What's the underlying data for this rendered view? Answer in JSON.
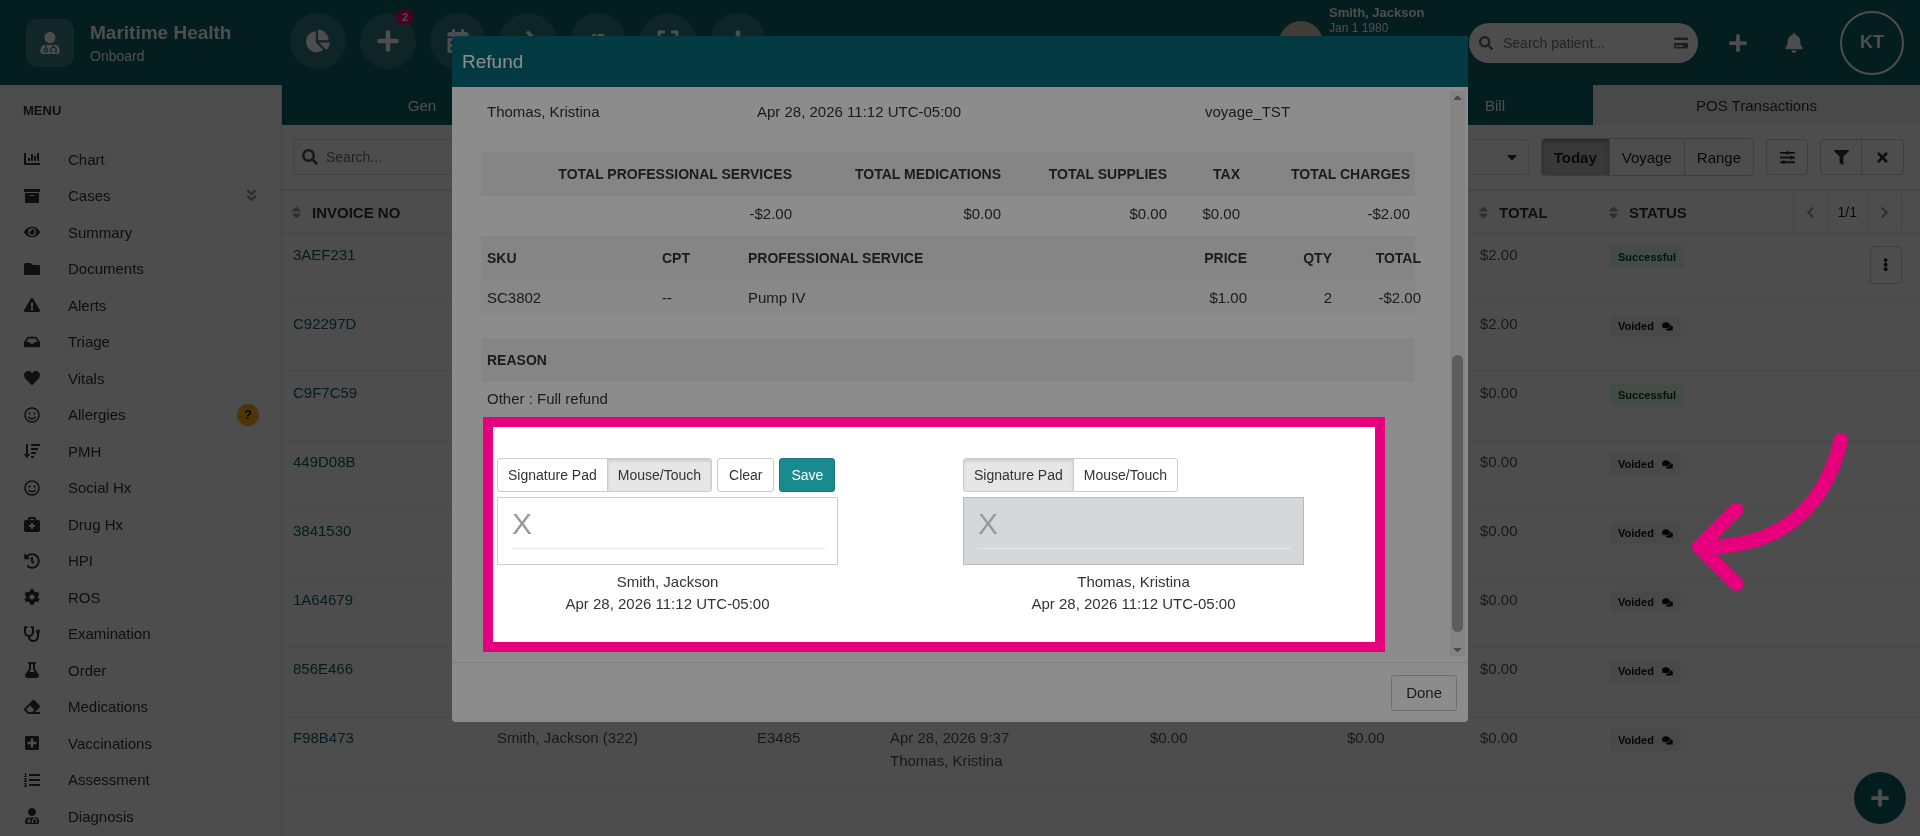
{
  "header": {
    "brand": {
      "name": "Maritime Health",
      "subtitle": "Onboard"
    },
    "new_count": "2",
    "patient": {
      "name": "Smith, Jackson",
      "dob": "Jan 1 1980"
    },
    "search": {
      "placeholder": "Search patient..."
    },
    "user_initials": "KT"
  },
  "sidebar": {
    "title": "MENU",
    "items": [
      {
        "label": "Chart",
        "expandable": false
      },
      {
        "label": "Cases",
        "expandable": true
      },
      {
        "label": "Summary",
        "expandable": false
      },
      {
        "label": "Documents",
        "expandable": false
      },
      {
        "label": "Alerts",
        "expandable": false
      },
      {
        "label": "Triage",
        "expandable": false
      },
      {
        "label": "Vitals",
        "expandable": false
      },
      {
        "label": "Allergies",
        "expandable": false,
        "badge": "?"
      },
      {
        "label": "PMH",
        "expandable": false
      },
      {
        "label": "Social Hx",
        "expandable": false
      },
      {
        "label": "Drug Hx",
        "expandable": false
      },
      {
        "label": "HPI",
        "expandable": false
      },
      {
        "label": "ROS",
        "expandable": false
      },
      {
        "label": "Examination",
        "expandable": false
      },
      {
        "label": "Order",
        "expandable": false
      },
      {
        "label": "Medications",
        "expandable": false
      },
      {
        "label": "Vaccinations",
        "expandable": false
      },
      {
        "label": "Assessment",
        "expandable": false
      },
      {
        "label": "Diagnosis",
        "expandable": false
      }
    ]
  },
  "tabs": [
    {
      "label": "Gen",
      "selected": false
    },
    {
      "label": "Bill",
      "selected": false
    },
    {
      "label": "POS Transactions",
      "selected": true
    }
  ],
  "toolbar": {
    "search_placeholder": "Search...",
    "ranges": [
      {
        "label": "Today",
        "selected": true
      },
      {
        "label": "Voyage",
        "selected": false
      },
      {
        "label": "Range",
        "selected": false
      }
    ]
  },
  "table": {
    "columns": [
      "INVOICE NO",
      "TOTAL",
      "STATUS"
    ],
    "pagination": "1/1",
    "rows": [
      {
        "invoice": "3AEF231",
        "total": "$2.00",
        "status": {
          "label": "Successful",
          "kind": "success"
        },
        "has_menu": true
      },
      {
        "invoice": "C92297D",
        "total": "$2.00",
        "status": {
          "label": "Voided",
          "kind": "voided"
        },
        "has_menu": false
      },
      {
        "invoice": "C9F7C59",
        "total": "$0.00",
        "status": {
          "label": "Successful",
          "kind": "success"
        },
        "has_menu": false
      },
      {
        "invoice": "449D08B",
        "total": "$0.00",
        "status": {
          "label": "Voided",
          "kind": "voided"
        },
        "has_menu": false
      },
      {
        "invoice": "3841530",
        "total": "$0.00",
        "status": {
          "label": "Voided",
          "kind": "voided"
        },
        "has_menu": false
      },
      {
        "invoice": "1A64679",
        "total": "$0.00",
        "status": {
          "label": "Voided",
          "kind": "voided"
        },
        "has_menu": false
      },
      {
        "invoice": "856E466",
        "total": "$0.00",
        "status": {
          "label": "Voided",
          "kind": "voided"
        },
        "has_menu": false
      },
      {
        "invoice": "F98B473",
        "total": "$0.00",
        "status": {
          "label": "Voided",
          "kind": "voided"
        },
        "has_menu": false,
        "cells": [
          [
            "Smith, Jackson (322)"
          ],
          [
            "E3485"
          ],
          [
            "Apr 28, 2026 9:37",
            "Thomas, Kristina"
          ],
          [
            "$0.00"
          ],
          [
            "$0.00"
          ]
        ]
      }
    ]
  },
  "modal": {
    "title": "Refund",
    "info": [
      "Thomas, Kristina",
      "Apr 28, 2026 11:12 UTC-05:00",
      "voyage_TST"
    ],
    "totals": {
      "columns": [
        "TOTAL PROFESSIONAL SERVICES",
        "TOTAL MEDICATIONS",
        "TOTAL SUPPLIES",
        "TAX",
        "TOTAL CHARGES"
      ],
      "values": [
        "-$2.00",
        "$0.00",
        "$0.00",
        "$0.00",
        "-$2.00"
      ]
    },
    "items": {
      "columns": [
        "SKU",
        "CPT",
        "PROFESSIONAL SERVICE",
        "PRICE",
        "QTY",
        "TOTAL"
      ],
      "rows": [
        [
          "SC3802",
          "--",
          "Pump IV",
          "$1.00",
          "2",
          "-$2.00"
        ]
      ]
    },
    "reason": {
      "heading": "REASON",
      "text": "Other : Full refund"
    },
    "signatures": [
      {
        "modes": [
          {
            "label": "Signature Pad",
            "selected": false
          },
          {
            "label": "Mouse/Touch",
            "selected": true
          }
        ],
        "actions": [
          {
            "label": "Clear",
            "kind": "plain"
          },
          {
            "label": "Save",
            "kind": "primary"
          }
        ],
        "disabled": false,
        "mark": "X",
        "name": "Smith, Jackson",
        "date": "Apr 28, 2026 11:12 UTC-05:00"
      },
      {
        "modes": [
          {
            "label": "Signature Pad",
            "selected": true
          },
          {
            "label": "Mouse/Touch",
            "selected": false
          }
        ],
        "disabled": true,
        "mark": "X",
        "name": "Thomas, Kristina",
        "date": "Apr 28, 2026 11:12 UTC-05:00"
      }
    ],
    "done": "Done"
  }
}
